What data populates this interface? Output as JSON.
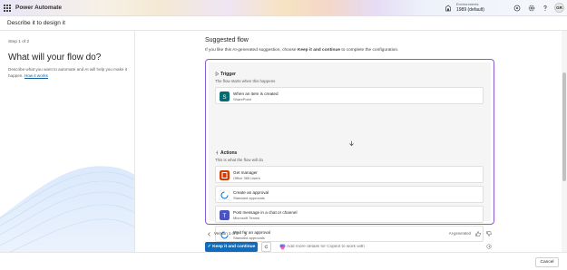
{
  "app": {
    "title": "Power Automate"
  },
  "environment": {
    "label": "Environments",
    "value": "1989 (default)"
  },
  "user": {
    "initials": "GR"
  },
  "subheader": {
    "title": "Describe it to design it"
  },
  "left": {
    "step": "Step 1 of 2",
    "heading": "What will your flow do?",
    "description": "Describe what you want to automate and AI will help you make it happen.",
    "link": "How it works"
  },
  "main": {
    "title": "Suggested flow",
    "desc_prefix": "If you like this AI-generated suggestion, choose",
    "desc_bold": "Keep it and continue",
    "desc_suffix": "to complete the configuration.",
    "trigger": {
      "title": "Trigger",
      "subtitle": "The flow starts when this happens",
      "card": {
        "name": "When an item is created",
        "connector": "SharePoint",
        "color": "#036c70"
      }
    },
    "actions": {
      "title": "Actions",
      "subtitle": "This is what the flow will do",
      "items": [
        {
          "name": "Get manager",
          "connector": "Office 365 Users",
          "color": "#d83b01"
        },
        {
          "name": "Create an approval",
          "connector": "Standard approvals",
          "color": "#0f6cbd"
        },
        {
          "name": "Post message in a chat or channel",
          "connector": "Microsoft Teams",
          "color": "#4b53bc"
        },
        {
          "name": "Wait for an approval",
          "connector": "Standard approvals",
          "color": "#0f6cbd"
        }
      ]
    },
    "version": "Version 1 of 2",
    "ai_generated": "AI-generated",
    "keep_button": "Keep it and continue",
    "copilot_placeholder": "Add more details for Copilot to work with"
  },
  "footer": {
    "cancel": "Cancel"
  }
}
